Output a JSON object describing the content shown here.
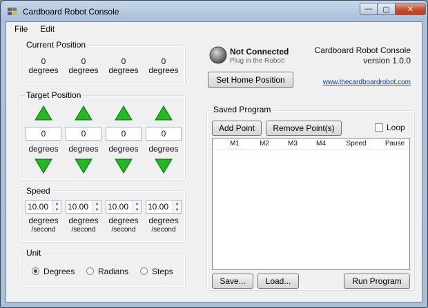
{
  "window": {
    "title": "Cardboard Robot Console"
  },
  "menu": {
    "file": "File",
    "edit": "Edit"
  },
  "current_position": {
    "title": "Current Position",
    "values": [
      "0",
      "0",
      "0",
      "0"
    ],
    "unit": "degrees"
  },
  "target_position": {
    "title": "Target Position",
    "values": [
      "0",
      "0",
      "0",
      "0"
    ],
    "unit": "degrees"
  },
  "speed": {
    "title": "Speed",
    "values": [
      "10.00",
      "10.00",
      "10.00",
      "10.00"
    ],
    "unit": "degrees",
    "sub": "/second"
  },
  "unit": {
    "title": "Unit",
    "options": [
      "Degrees",
      "Radians",
      "Steps"
    ],
    "selected": "Degrees"
  },
  "status": {
    "text": "Not Connected",
    "hint": "Plug in the Robot!",
    "set_home": "Set Home Position"
  },
  "about": {
    "name": "Cardboard Robot Console",
    "version": "version 1.0.0",
    "link": "www.thecardboardrobot.com"
  },
  "saved_program": {
    "title": "Saved Program",
    "add_point": "Add Point",
    "remove_point": "Remove Point(s)",
    "loop": "Loop",
    "loop_checked": false,
    "columns": [
      "M1",
      "M2",
      "M3",
      "M4",
      "Speed",
      "Pause"
    ],
    "rows": [],
    "save": "Save...",
    "load": "Load...",
    "run": "Run Program"
  },
  "colors": {
    "arrow_green": "#22b922",
    "link": "#0645ad"
  }
}
